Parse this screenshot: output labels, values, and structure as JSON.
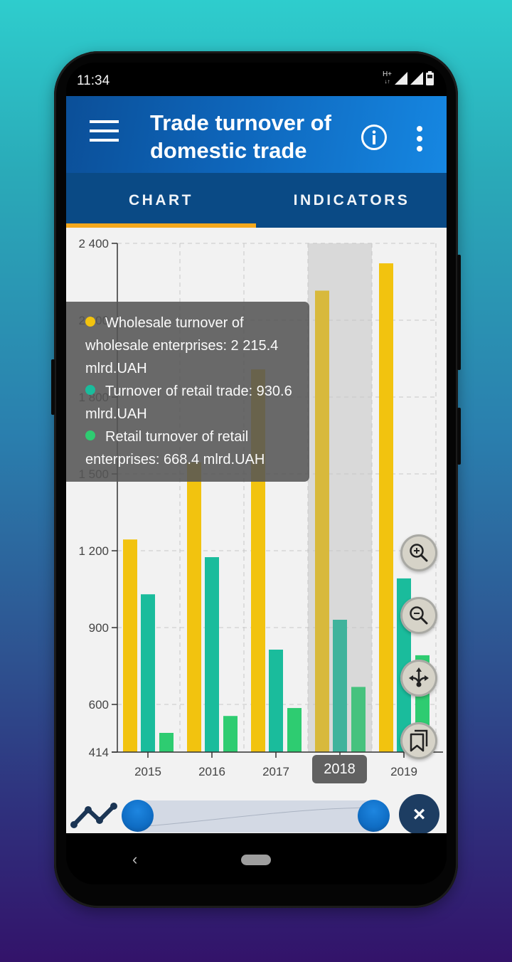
{
  "status_bar": {
    "time": "11:34",
    "network": "H+",
    "icons": [
      "network-type-icon",
      "signal-icon",
      "signal-icon",
      "battery-icon"
    ]
  },
  "app_bar": {
    "title": "Trade turnover of domestic trade",
    "title_line1": "Trade turnover of",
    "title_line2": "domestic trade",
    "menu_icon": "hamburger-menu-icon",
    "info_icon": "info-icon",
    "more_icon": "more-vert-icon"
  },
  "tabs": [
    {
      "label": "CHART",
      "active": true
    },
    {
      "label": "INDICATORS",
      "active": false
    }
  ],
  "colors": {
    "wholesale": "#f2c30f",
    "retail_trade": "#1abc9c",
    "retail_enterprises": "#2ecc71",
    "tab_indicator": "#f5a81c",
    "app_bar": "#0e66bb",
    "tab_bar": "#0a4a85"
  },
  "chart_data": {
    "type": "bar",
    "title": "Trade turnover of domestic trade",
    "xlabel": "",
    "ylabel": "",
    "unit": "mlrd.UAH",
    "categories": [
      "2015",
      "2016",
      "2017",
      "2018",
      "2019"
    ],
    "series": [
      {
        "name": "Wholesale turnover of wholesale enterprises",
        "values": [
          1244,
          1545,
          1908,
          2215.4,
          2322
        ]
      },
      {
        "name": "Turnover of retail trade",
        "values": [
          1030,
          1175,
          814,
          930.6,
          1092
        ]
      },
      {
        "name": "Retail turnover of retail enterprises",
        "values": [
          489,
          555,
          586,
          668.4,
          792
        ]
      }
    ],
    "ylim": [
      414,
      2400
    ],
    "y_ticks": [
      414,
      600,
      900,
      1200,
      1500,
      1800,
      2100,
      2400
    ],
    "y_tick_labels": [
      "414",
      "600",
      "900",
      "1 200",
      "1 500",
      "1 800",
      "2 100",
      "2 400"
    ],
    "grid": true,
    "highlighted_category": "2018"
  },
  "tooltip": {
    "items": [
      {
        "color": "#f2c30f",
        "text": "Wholesale turnover of wholesale enterprises: 2 215.4 mlrd.UAH"
      },
      {
        "color": "#1abc9c",
        "text": "Turnover of retail trade: 930.6 mlrd.UAH"
      },
      {
        "color": "#2ecc71",
        "text": "Retail turnover of retail enterprises: 668.4 mlrd.UAH"
      }
    ]
  },
  "x_badge": "2018",
  "fabs": [
    {
      "name": "zoom-in",
      "icon": "zoom-in-icon"
    },
    {
      "name": "zoom-out",
      "icon": "zoom-out-icon"
    },
    {
      "name": "pan",
      "icon": "pan-arrows-icon"
    },
    {
      "name": "bookmarks",
      "icon": "bookmarks-icon"
    }
  ],
  "range_slider": {
    "start": 0,
    "end": 1
  },
  "bottom": {
    "chart_type_icon": "line-chart-icon",
    "close_icon": "close-icon",
    "close_label": "×"
  },
  "nav": {
    "back": "‹"
  }
}
